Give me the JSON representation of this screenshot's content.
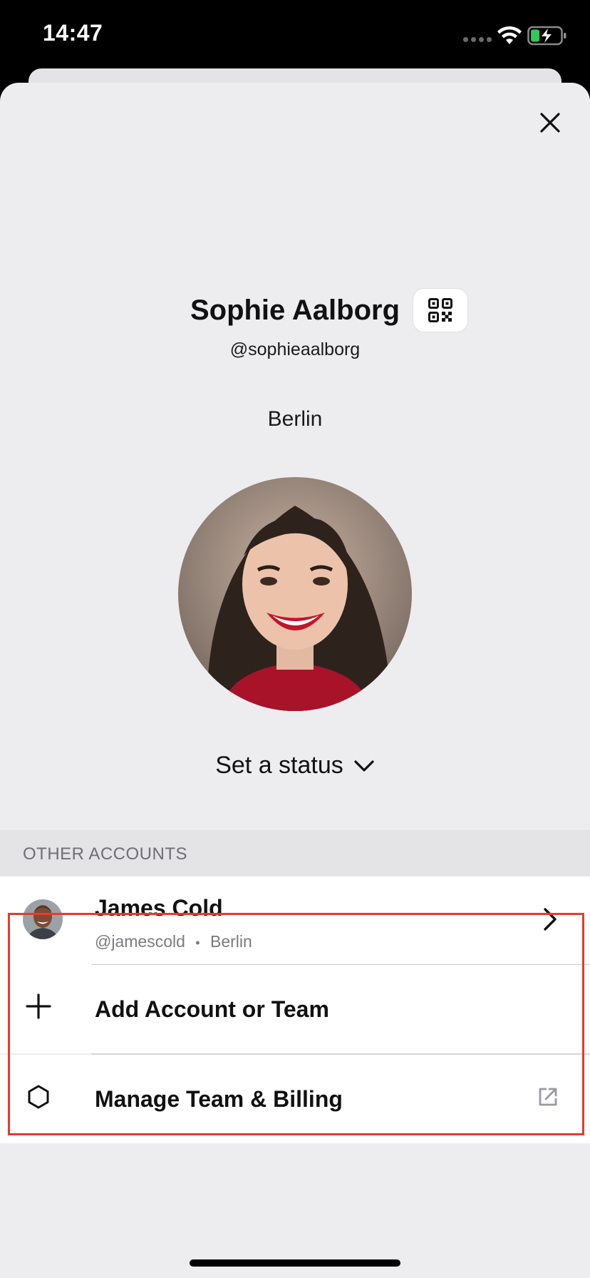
{
  "status_bar": {
    "time": "14:47"
  },
  "profile": {
    "name": "Sophie Aalborg",
    "handle": "@sophieaalborg",
    "location": "Berlin",
    "set_status_label": "Set a status"
  },
  "other_accounts": {
    "header": "OTHER ACCOUNTS",
    "accounts": [
      {
        "name": "James Cold",
        "handle": "@jamescold",
        "separator": "•",
        "location": "Berlin"
      }
    ],
    "add_label": "Add Account or Team"
  },
  "manage": {
    "label": "Manage Team & Billing"
  },
  "colors": {
    "highlight": "#e53b2c",
    "battery_green": "#34c759",
    "sheet_bg": "#ededf0"
  },
  "icons": [
    "close-icon",
    "qr-code-icon",
    "chevron-down-icon",
    "chevron-right-icon",
    "plus-icon",
    "hexagon-icon",
    "external-link-icon",
    "wifi-icon",
    "battery-icon"
  ]
}
